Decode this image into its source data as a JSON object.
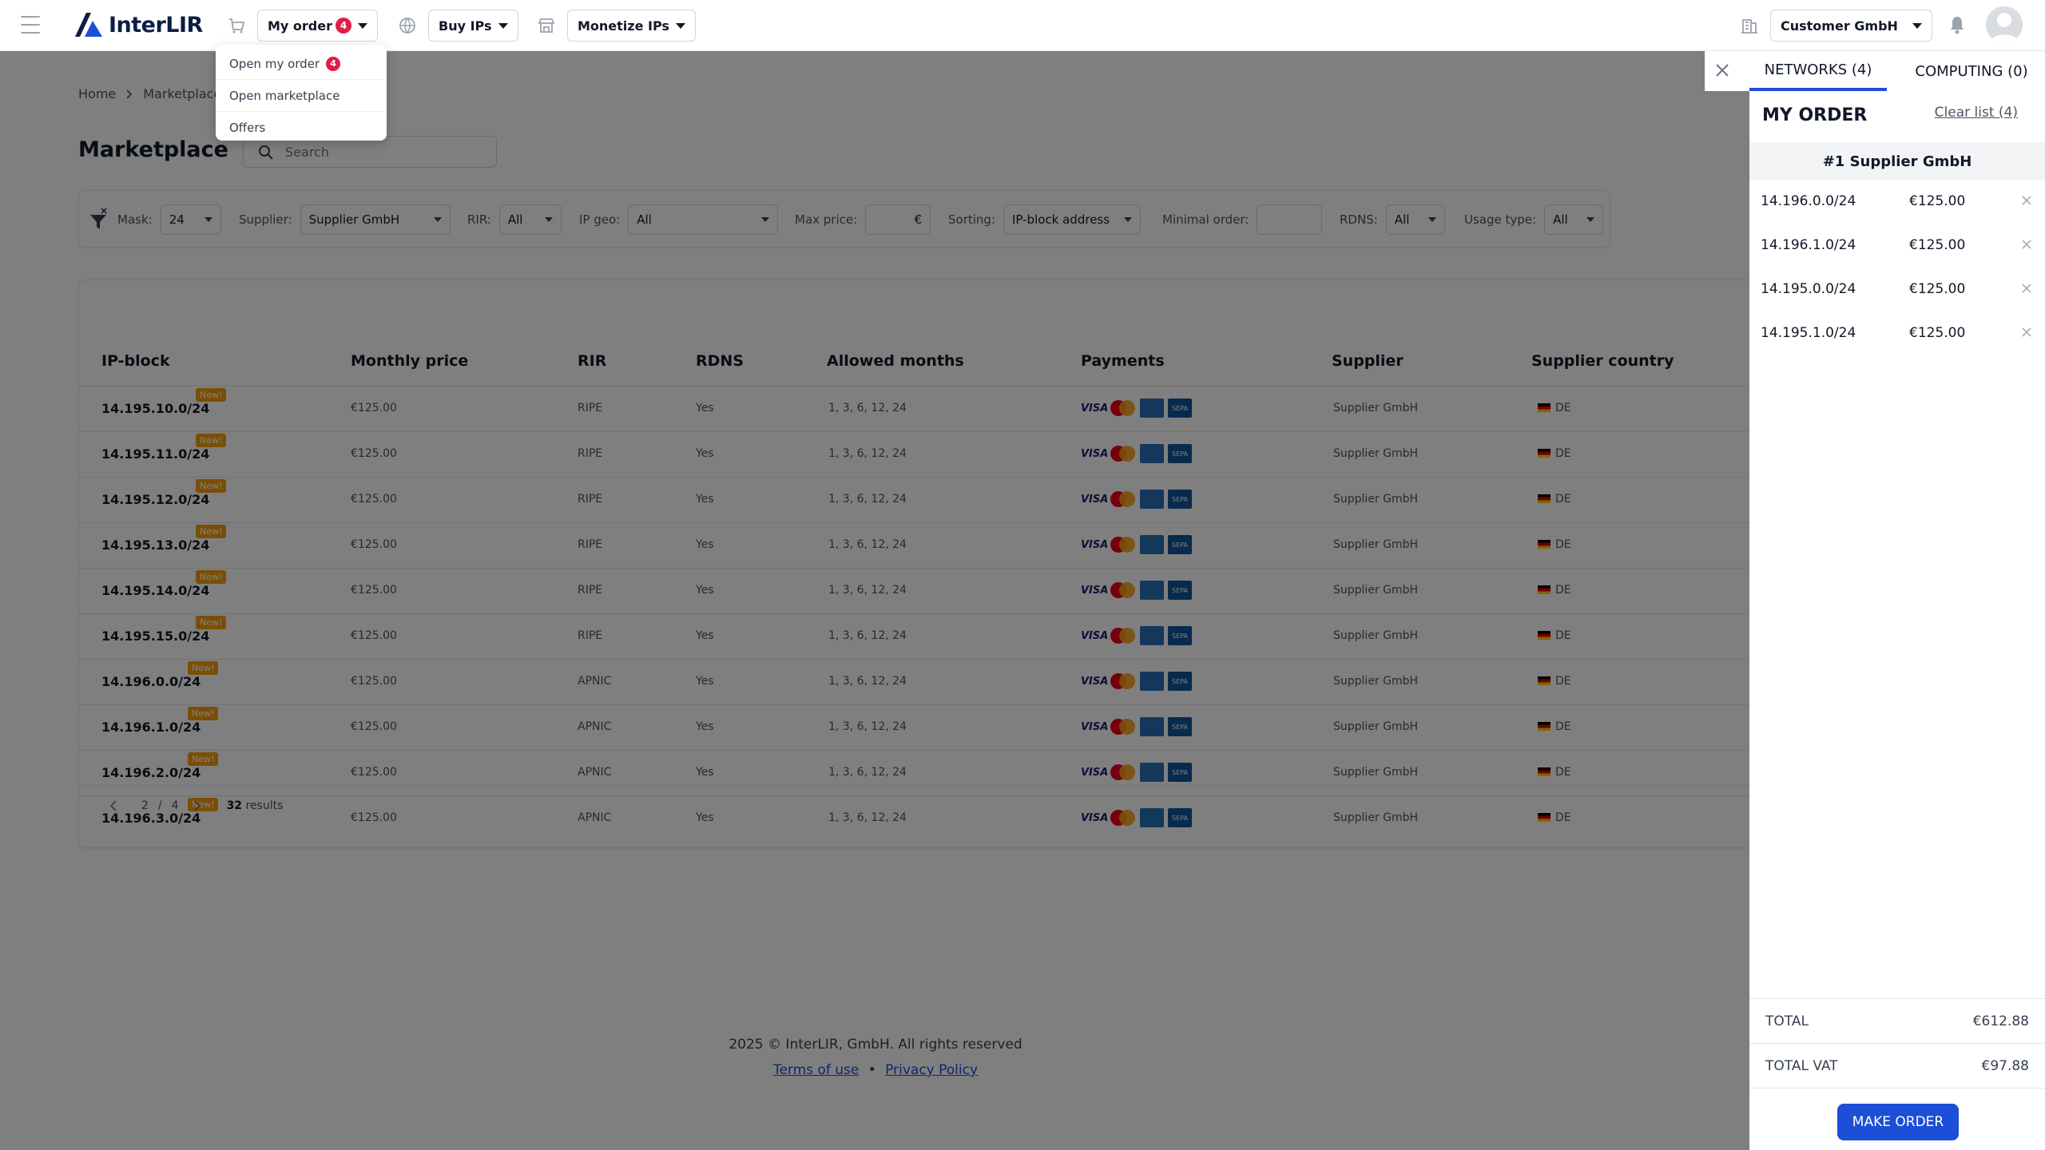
{
  "header": {
    "brand": "InterLIR",
    "my_order_label": "My order",
    "my_order_count": "4",
    "buy_ips_label": "Buy IPs",
    "monetize_ips_label": "Monetize IPs",
    "account_label": "Customer GmbH"
  },
  "order_menu": {
    "items": [
      {
        "label": "Open my order",
        "badge": "4"
      },
      {
        "label": "Open marketplace"
      },
      {
        "label": "Offers"
      }
    ]
  },
  "breadcrumb": [
    "Home",
    "Marketplace"
  ],
  "page": {
    "title": "Marketplace",
    "search_placeholder": "Search"
  },
  "filters": {
    "mask": {
      "label": "Mask:",
      "value": "24"
    },
    "supplier": {
      "label": "Supplier:",
      "value": "Supplier GmbH"
    },
    "rir": {
      "label": "RIR:",
      "value": "All"
    },
    "ip_geo": {
      "label": "IP geo:",
      "value": "All"
    },
    "max_price": {
      "label": "Max price:",
      "currency": "€"
    },
    "sorting": {
      "label": "Sorting:",
      "value": "IP-block address"
    },
    "minimal_order": {
      "label": "Minimal order:"
    },
    "rdns": {
      "label": "RDNS:",
      "value": "All"
    },
    "usage_type": {
      "label": "Usage type:",
      "value": "All"
    }
  },
  "table": {
    "columns": [
      "IP-block",
      "Monthly price",
      "RIR",
      "RDNS",
      "Allowed months",
      "Payments",
      "Supplier",
      "Supplier country"
    ],
    "new_badge": "New!",
    "rows": [
      {
        "ip": "14.195.10.0/24",
        "price": "€125.00",
        "rir": "RIPE",
        "rdns": "Yes",
        "months": "1, 3, 6, 12, 24",
        "supplier": "Supplier GmbH",
        "country": "DE"
      },
      {
        "ip": "14.195.11.0/24",
        "price": "€125.00",
        "rir": "RIPE",
        "rdns": "Yes",
        "months": "1, 3, 6, 12, 24",
        "supplier": "Supplier GmbH",
        "country": "DE"
      },
      {
        "ip": "14.195.12.0/24",
        "price": "€125.00",
        "rir": "RIPE",
        "rdns": "Yes",
        "months": "1, 3, 6, 12, 24",
        "supplier": "Supplier GmbH",
        "country": "DE"
      },
      {
        "ip": "14.195.13.0/24",
        "price": "€125.00",
        "rir": "RIPE",
        "rdns": "Yes",
        "months": "1, 3, 6, 12, 24",
        "supplier": "Supplier GmbH",
        "country": "DE"
      },
      {
        "ip": "14.195.14.0/24",
        "price": "€125.00",
        "rir": "RIPE",
        "rdns": "Yes",
        "months": "1, 3, 6, 12, 24",
        "supplier": "Supplier GmbH",
        "country": "DE"
      },
      {
        "ip": "14.195.15.0/24",
        "price": "€125.00",
        "rir": "RIPE",
        "rdns": "Yes",
        "months": "1, 3, 6, 12, 24",
        "supplier": "Supplier GmbH",
        "country": "DE"
      },
      {
        "ip": "14.196.0.0/24",
        "price": "€125.00",
        "rir": "APNIC",
        "rdns": "Yes",
        "months": "1, 3, 6, 12, 24",
        "supplier": "Supplier GmbH",
        "country": "DE"
      },
      {
        "ip": "14.196.1.0/24",
        "price": "€125.00",
        "rir": "APNIC",
        "rdns": "Yes",
        "months": "1, 3, 6, 12, 24",
        "supplier": "Supplier GmbH",
        "country": "DE"
      },
      {
        "ip": "14.196.2.0/24",
        "price": "€125.00",
        "rir": "APNIC",
        "rdns": "Yes",
        "months": "1, 3, 6, 12, 24",
        "supplier": "Supplier GmbH",
        "country": "DE"
      },
      {
        "ip": "14.196.3.0/24",
        "price": "€125.00",
        "rir": "APNIC",
        "rdns": "Yes",
        "months": "1, 3, 6, 12, 24",
        "supplier": "Supplier GmbH",
        "country": "DE"
      }
    ],
    "payments": {
      "visa": "VISA",
      "sepa": "SEPA"
    }
  },
  "pagination": {
    "current": "2",
    "separator": "/",
    "total": "4",
    "results_count": "32",
    "results_label": "results"
  },
  "footer": {
    "copyright": "2025 © InterLIR, GmbH. All rights reserved",
    "terms": "Terms of use",
    "bullet": "•",
    "privacy": "Privacy Policy"
  },
  "side_panel": {
    "tabs": [
      "NETWORKS (4)",
      "COMPUTING (0)"
    ],
    "title": "MY ORDER",
    "clear_list": "Clear list (4)",
    "supplier_group": "#1 Supplier GmbH",
    "items": [
      {
        "ip": "14.196.0.0/24",
        "price": "€125.00"
      },
      {
        "ip": "14.196.1.0/24",
        "price": "€125.00"
      },
      {
        "ip": "14.195.0.0/24",
        "price": "€125.00"
      },
      {
        "ip": "14.195.1.0/24",
        "price": "€125.00"
      }
    ],
    "total_label": "TOTAL",
    "total_value": "€612.88",
    "vat_label": "TOTAL VAT",
    "vat_value": "€97.88",
    "make_order": "MAKE ORDER"
  },
  "colors": {
    "accent": "#1d4ed8",
    "badge_red": "#e11d48",
    "new_badge": "#f59e0b",
    "overlay": "rgba(0,0,0,0.5)"
  }
}
